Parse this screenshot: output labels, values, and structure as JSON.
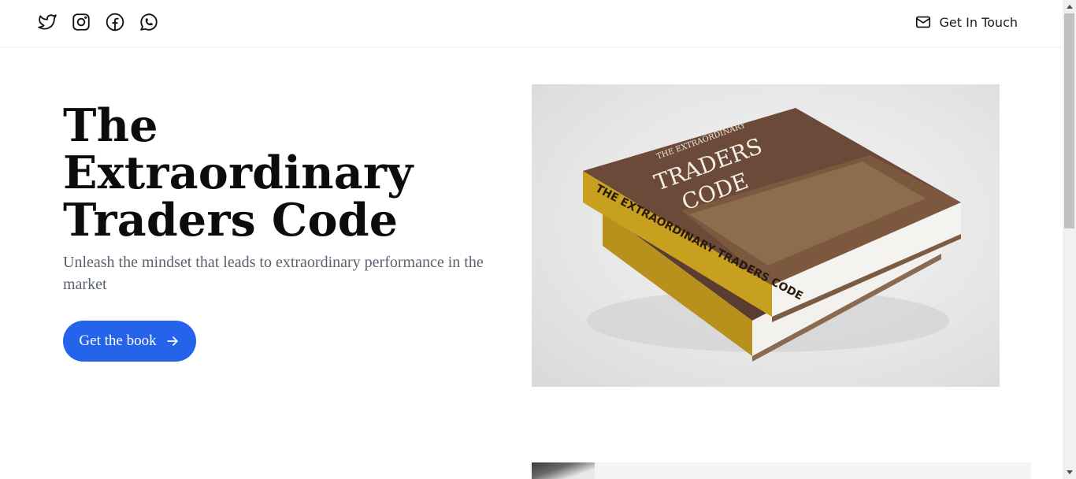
{
  "header": {
    "social_icons": [
      "twitter-icon",
      "instagram-icon",
      "facebook-icon",
      "whatsapp-icon"
    ],
    "contact_label": "Get In Touch",
    "contact_icon": "mail-icon"
  },
  "hero": {
    "title_line1": "The",
    "title_line2": "Extraordinary",
    "title_line3": "Traders Code",
    "subtitle": "Unleash the mindset that leads to extraordinary performance in the market",
    "cta_label": "Get the book",
    "cta_icon": "arrow-right-icon",
    "cta_color": "#2563eb"
  },
  "book_cover": {
    "title_small": "THE EXTRAORDINARY",
    "title_big_1": "TRADERS",
    "title_big_2": "CODE",
    "spine_text": "THE EXTRAORDINARY TRADERS CODE",
    "colors": {
      "cover": "#6b4a3a",
      "spine": "#c8a020"
    }
  }
}
